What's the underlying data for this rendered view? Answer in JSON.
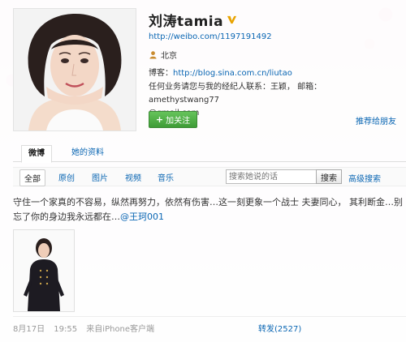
{
  "profile": {
    "name": "刘涛tamia",
    "url": "http://weibo.com/1197191492",
    "location": "北京",
    "blog_label": "博客：",
    "blog_url": "http://blog.sina.com.cn/liutao",
    "contact_line1": "任何业务请您与我的经纪人联系：王颖，  邮箱：amethystwang77",
    "contact_line2": "@gmail.com",
    "follow_button": "加关注",
    "recommend_link": "推荐给朋友",
    "verified_icon": "verified-v-icon",
    "accent_color": "#0a66b3"
  },
  "tabs": [
    {
      "label": "微博"
    },
    {
      "label": "她的资料"
    }
  ],
  "filters": {
    "items": [
      "全部",
      "原创",
      "图片",
      "视频",
      "音乐"
    ],
    "search_placeholder": "搜索她说的话",
    "search_button": "搜索",
    "advanced_search": "高级搜索"
  },
  "post": {
    "text": "守住一个家真的不容易，纵然再努力，依然有伤害…这一刻更象一个战士 夫妻同心，  其利断金…别忘了你的身边我永远都在…",
    "mention": "@王珂001",
    "date": "8月17日",
    "time": "19:55",
    "source": "来自iPhone客户端",
    "repost": "转发(2527)"
  }
}
